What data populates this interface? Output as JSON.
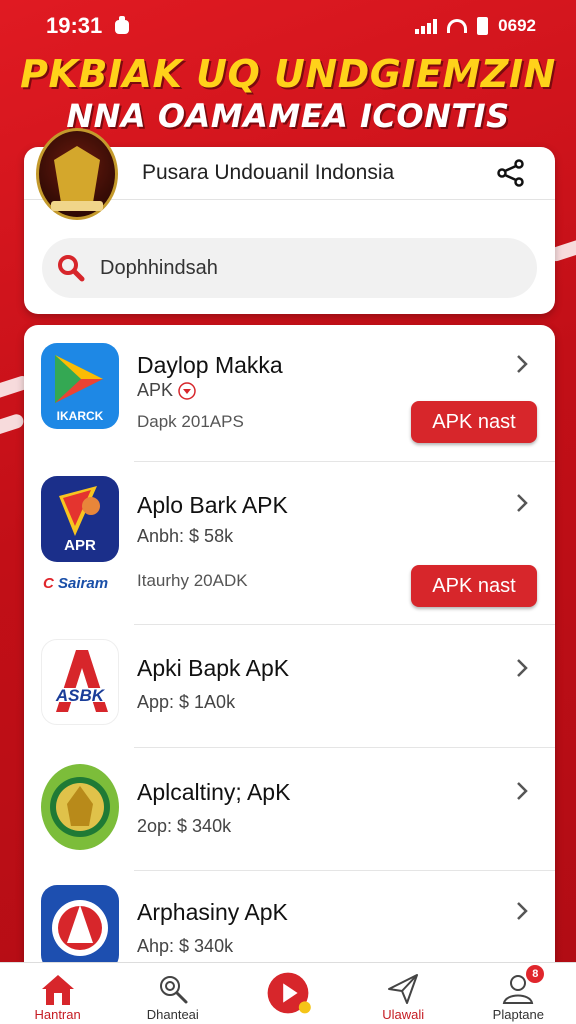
{
  "status_bar": {
    "time": "19:31",
    "battery": "0692"
  },
  "headline": {
    "line1": "PKBIAK UQ UNDGIEMZIN",
    "line2": "NNA OAMAMEA ICONTIS"
  },
  "header": {
    "title": "Pusara Undouanil Indonsia"
  },
  "search": {
    "value": "Dophhindsah"
  },
  "apps": [
    {
      "name": "Daylop Makka",
      "sub": "APK",
      "sub2": "Dapk 201APS",
      "button": "APK nast",
      "icon_text": "IKARCK"
    },
    {
      "name": "Aplo Bark APK",
      "sub": "Anbh: $ 58k",
      "sub2": "Itaurhy 20ADK",
      "button": "APK nast",
      "icon_text": "APR",
      "brand_blue": "C",
      "brand_red": "Sairam"
    },
    {
      "name": "Apki Bapk ApK",
      "sub": "App: $ 1A0k",
      "icon_text": "ASBK"
    },
    {
      "name": "Aplcaltiny; ApK",
      "sub": "2op: $ 340k"
    },
    {
      "name": "Arphasiny ApK",
      "sub": "Ahp: $ 340k"
    }
  ],
  "bottom_nav": [
    {
      "label": "Hantran",
      "icon": "home-icon",
      "active": true
    },
    {
      "label": "Dhanteai",
      "icon": "settings-search-icon"
    },
    {
      "label": "",
      "icon": "play-icon"
    },
    {
      "label": "Ulawali",
      "icon": "send-icon",
      "active": true
    },
    {
      "label": "Plaptane",
      "icon": "profile-icon",
      "badge": "8"
    }
  ],
  "colors": {
    "brand_red": "#c8111a",
    "button_red": "#d7262b",
    "headline_yellow": "#ffd21a"
  }
}
